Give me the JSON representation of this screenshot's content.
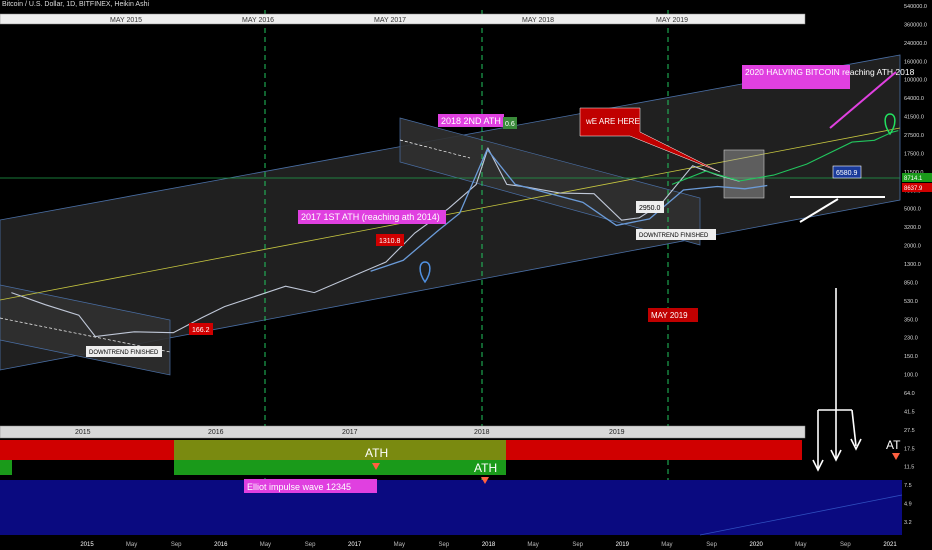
{
  "header": {
    "symbol_title": "Bitcoin / U.S. Dollar, 1D, BITFINEX, Heikin Ashi"
  },
  "colors": {
    "background": "#000000",
    "price": "#c0c8d8",
    "projection_green": "#22c55e",
    "projection_blue": "#6b9bd8",
    "magenta": "#e040e0",
    "red_label": "#d00000",
    "yellow_line": "#c8c840",
    "channel_fill": "#2a2a2a"
  },
  "chart_data": {
    "type": "line",
    "title": "",
    "xlabel": "",
    "ylabel": "",
    "y_scale": "log",
    "ylim": [
      2.6,
      600000
    ],
    "xlim": [
      "2014-05-01",
      "2021-01-15"
    ],
    "x_ticks": [
      "2015",
      "May",
      "Sep",
      "2016",
      "May",
      "Sep",
      "2017",
      "May",
      "Sep",
      "2018",
      "May",
      "Sep",
      "2019",
      "May",
      "Sep",
      "2020",
      "May",
      "Sep",
      "2021"
    ],
    "y_ticks": [
      "540000.0",
      "360000.0",
      "240000.0",
      "160000.0",
      "100000.0",
      "64000.0",
      "41500.0",
      "27500.0",
      "17500.0",
      "11500.0",
      "7500.0",
      "5000.0",
      "3200.0",
      "2000.0",
      "1300.0",
      "850.0",
      "530.0",
      "350.0",
      "230.0",
      "150.0",
      "100.0",
      "64.0",
      "41.5",
      "27.5",
      "17.5",
      "11.5",
      "7.5",
      "4.9",
      "3.2"
    ],
    "current_price_labels": [
      "8714.1",
      "8637.9"
    ],
    "top_bar_labels": [
      "MAY 2015",
      "MAY 2016",
      "MAY 2017",
      "MAY 2018",
      "MAY 2019"
    ],
    "lower_bar_years": [
      "2015",
      "2016",
      "2017",
      "2018",
      "2019"
    ],
    "series": [
      {
        "values": [
          {
            "x": "2014-06-01",
            "y": 600
          },
          {
            "x": "2014-09-01",
            "y": 450
          },
          {
            "x": "2014-12-01",
            "y": 350
          },
          {
            "x": "2015-01-15",
            "y": 210
          },
          {
            "x": "2015-05-01",
            "y": 235
          },
          {
            "x": "2015-08-15",
            "y": 230
          },
          {
            "x": "2015-11-01",
            "y": 330
          },
          {
            "x": "2016-01-01",
            "y": 430
          },
          {
            "x": "2016-06-15",
            "y": 700
          },
          {
            "x": "2016-09-01",
            "y": 600
          },
          {
            "x": "2017-01-01",
            "y": 950
          },
          {
            "x": "2017-03-15",
            "y": 1250
          },
          {
            "x": "2017-06-01",
            "y": 2500
          },
          {
            "x": "2017-09-01",
            "y": 4500
          },
          {
            "x": "2017-11-15",
            "y": 8000
          },
          {
            "x": "2017-12-17",
            "y": 19000
          },
          {
            "x": "2018-02-06",
            "y": 8000
          },
          {
            "x": "2018-04-01",
            "y": 7500
          },
          {
            "x": "2018-07-01",
            "y": 6500
          },
          {
            "x": "2018-10-01",
            "y": 6400
          },
          {
            "x": "2018-12-15",
            "y": 3400
          },
          {
            "x": "2019-02-01",
            "y": 3600
          },
          {
            "x": "2019-04-01",
            "y": 5000
          },
          {
            "x": "2019-06-26",
            "y": 12500
          },
          {
            "x": "2019-09-01",
            "y": 10000
          },
          {
            "x": "2019-11-01",
            "y": 8600
          }
        ]
      },
      {
        "values": [
          {
            "x": "2019-05-01",
            "y": 8000
          },
          {
            "x": "2019-08-01",
            "y": 11000
          },
          {
            "x": "2019-11-01",
            "y": 8700
          },
          {
            "x": "2020-02-01",
            "y": 10000
          },
          {
            "x": "2020-05-01",
            "y": 13000
          },
          {
            "x": "2020-09-01",
            "y": 22000
          },
          {
            "x": "2020-11-01",
            "y": 23000
          },
          {
            "x": "2020-12-20",
            "y": 28000
          },
          {
            "x": "2021-01-05",
            "y": 29000
          }
        ]
      },
      {
        "values": [
          {
            "x": "2017-02-01",
            "y": 1000
          },
          {
            "x": "2017-05-01",
            "y": 1300
          },
          {
            "x": "2017-08-01",
            "y": 2600
          },
          {
            "x": "2017-10-01",
            "y": 4000
          },
          {
            "x": "2017-12-15",
            "y": 18500
          },
          {
            "x": "2018-03-01",
            "y": 8000
          },
          {
            "x": "2018-09-01",
            "y": 5200
          },
          {
            "x": "2018-12-01",
            "y": 3000
          },
          {
            "x": "2019-03-01",
            "y": 3500
          },
          {
            "x": "2019-06-01",
            "y": 7000
          },
          {
            "x": "2019-09-01",
            "y": 7600
          },
          {
            "x": "2019-11-15",
            "y": 7200
          },
          {
            "x": "2020-01-15",
            "y": 7800
          }
        ]
      }
    ]
  },
  "annotations": {
    "ath_2018": "2018 2ND ATH",
    "ath_2018_value": "0.6",
    "ath_2017": "2017 1ST ATH (reaching ath 2014)",
    "we_are_here": "wE ARE HERE",
    "halving": "2020 HALVING BITCOIN reaching ATH 2018",
    "may_2019": "MAY 2019",
    "downtrend_1": "DOWNTREND FINISHED",
    "downtrend_2": "DOWNTREND FINISHED",
    "price_166": "166.2",
    "price_1310": "1310.8",
    "price_2950": "2950.0",
    "price_6580": "6580.9",
    "elliot": "Elliot impulse wave 12345",
    "ath_left": "ATH",
    "ath_right": "ATH",
    "at_edge": "AT"
  }
}
